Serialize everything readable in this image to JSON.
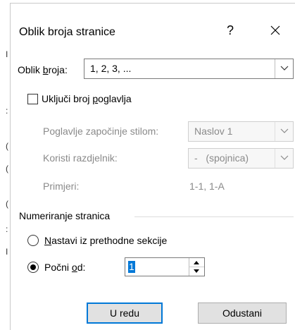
{
  "dialog": {
    "title": "Oblik broja stranice",
    "help_label": "?",
    "close_label": "✕"
  },
  "number_format": {
    "label_prefix": "Oblik ",
    "label_hotkey": "b",
    "label_suffix": "roja:",
    "value": "1, 2, 3, ..."
  },
  "chapter": {
    "include_prefix": "Uključi broj ",
    "include_hotkey": "p",
    "include_suffix": "oglavlja",
    "include_checked": false,
    "starts_with_label": "Poglavlje započinje stilom:",
    "starts_with_value": "Naslov 1",
    "separator_label": "Koristi razdjelnik:",
    "separator_value": "-   (spojnica)",
    "examples_label": "Primjeri:",
    "examples_value": "1-1, 1-A"
  },
  "page_numbering": {
    "group_label": "Numeriranje stranica",
    "continue_hotkey": "N",
    "continue_suffix": "astavi iz prethodne sekcije",
    "start_prefix": "Počni ",
    "start_hotkey": "o",
    "start_suffix": "d:",
    "start_value": "1",
    "selected": "start_at"
  },
  "buttons": {
    "ok": "U redu",
    "cancel": "Odustani"
  },
  "colors": {
    "accent": "#0078d7",
    "button_bg": "#e1e1e1",
    "disabled_text": "#8a8a8a"
  }
}
